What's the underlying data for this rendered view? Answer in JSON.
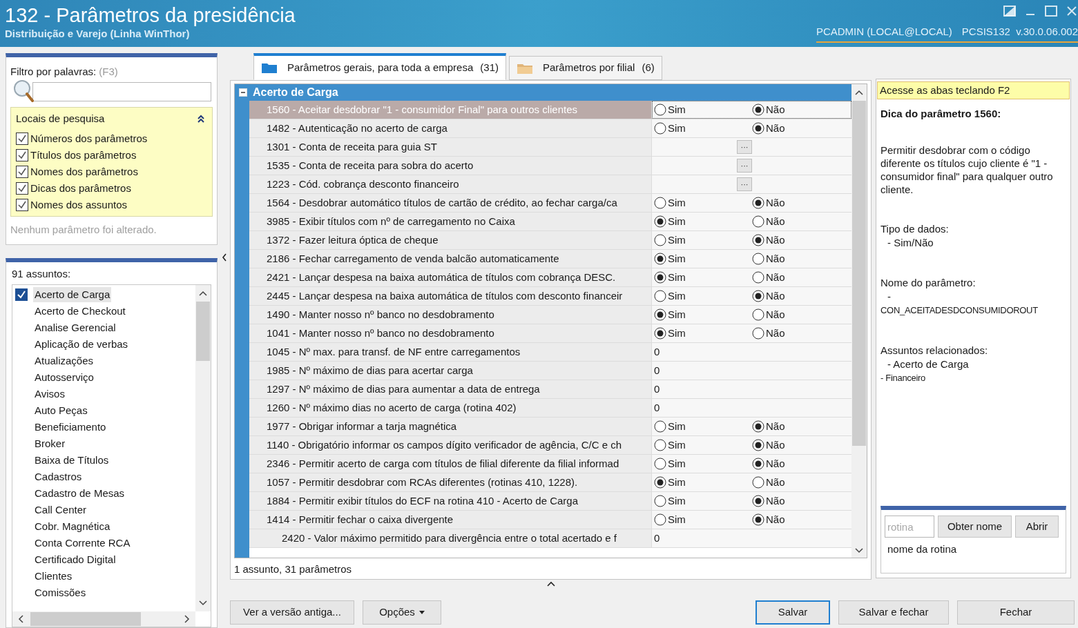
{
  "window": {
    "title": "132 - Parâmetros da presidência",
    "subtitle": "Distribuição e Varejo (Linha WinThor)",
    "user_info": "PCADMIN (LOCAL@LOCAL)",
    "routine_info": "PCSIS132  v.30.0.06.002"
  },
  "filter": {
    "label": "Filtro por palavras:",
    "shortcut": "(F3)",
    "search_places": {
      "title": "Locais de pesquisa",
      "expanded": true,
      "options": [
        {
          "label": "Números dos parâmetros",
          "checked": true
        },
        {
          "label": "Títulos dos parâmetros",
          "checked": true
        },
        {
          "label": "Nomes dos parâmetros",
          "checked": true
        },
        {
          "label": "Dicas dos parâmetros",
          "checked": true
        },
        {
          "label": "Nomes dos assuntos",
          "checked": true
        }
      ]
    },
    "status": "Nenhum parâmetro foi alterado."
  },
  "subjects": {
    "title": "91 assuntos:",
    "items": [
      {
        "label": "Acerto de Carga",
        "checked": true,
        "selected": true
      },
      {
        "label": "Acerto de Checkout",
        "checked": false,
        "selected": false
      },
      {
        "label": "Analise Gerencial",
        "checked": false,
        "selected": false
      },
      {
        "label": "Aplicação de verbas",
        "checked": false,
        "selected": false
      },
      {
        "label": "Atualizações",
        "checked": false,
        "selected": false
      },
      {
        "label": "Autosserviço",
        "checked": false,
        "selected": false
      },
      {
        "label": "Avisos",
        "checked": false,
        "selected": false
      },
      {
        "label": "Auto Peças",
        "checked": false,
        "selected": false
      },
      {
        "label": "Beneficiamento",
        "checked": false,
        "selected": false
      },
      {
        "label": "Broker",
        "checked": false,
        "selected": false
      },
      {
        "label": "Baixa de Títulos",
        "checked": false,
        "selected": false
      },
      {
        "label": "Cadastros",
        "checked": false,
        "selected": false
      },
      {
        "label": "Cadastro de Mesas",
        "checked": false,
        "selected": false
      },
      {
        "label": "Call Center",
        "checked": false,
        "selected": false
      },
      {
        "label": "Cobr. Magnética",
        "checked": false,
        "selected": false
      },
      {
        "label": "Conta Corrente RCA",
        "checked": false,
        "selected": false
      },
      {
        "label": "Certificado Digital",
        "checked": false,
        "selected": false
      },
      {
        "label": "Clientes",
        "checked": false,
        "selected": false
      },
      {
        "label": "Comissões",
        "checked": false,
        "selected": false
      }
    ]
  },
  "tabs": [
    {
      "label": "Parâmetros gerais, para toda a empresa",
      "count": "(31)",
      "selected": true
    },
    {
      "label": "Parâmetros por filial",
      "count": "(6)",
      "selected": false
    }
  ],
  "grid": {
    "group": "Acerto de Carga",
    "expanded": true,
    "rows": [
      {
        "kind": "bool",
        "label": "1560 - Aceitar desdobrar \"1 - consumidor Final\" para outros clientes",
        "selected": true,
        "options": [
          {
            "label": "Sim",
            "selected": false
          },
          {
            "label": "Não",
            "selected": true
          }
        ]
      },
      {
        "kind": "bool",
        "label": "1482 - Autenticação no acerto de carga",
        "selected": false,
        "options": [
          {
            "label": "Sim",
            "selected": false
          },
          {
            "label": "Não",
            "selected": true
          }
        ]
      },
      {
        "kind": "lookup",
        "label": "1301 - Conta de receita para guia ST",
        "selected": false,
        "button": "···"
      },
      {
        "kind": "lookup",
        "label": "1535 - Conta de receita para sobra do acerto",
        "selected": false,
        "button": "···"
      },
      {
        "kind": "lookup",
        "label": "1223 - Cód. cobrança desconto financeiro",
        "selected": false,
        "button": "···"
      },
      {
        "kind": "bool",
        "label": "1564 - Desdobrar automático títulos de cartão de crédito, ao fechar carga/ca",
        "selected": false,
        "options": [
          {
            "label": "Sim",
            "selected": false
          },
          {
            "label": "Não",
            "selected": true
          }
        ]
      },
      {
        "kind": "bool",
        "label": "3985 - Exibir títulos com nº de carregamento no Caixa",
        "selected": false,
        "options": [
          {
            "label": "Sim",
            "selected": true
          },
          {
            "label": "Não",
            "selected": false
          }
        ]
      },
      {
        "kind": "bool",
        "label": "1372 - Fazer leitura óptica de cheque",
        "selected": false,
        "options": [
          {
            "label": "Sim",
            "selected": false
          },
          {
            "label": "Não",
            "selected": true
          }
        ]
      },
      {
        "kind": "bool",
        "label": "2186 - Fechar carregamento de venda balcão automaticamente",
        "selected": false,
        "options": [
          {
            "label": "Sim",
            "selected": true
          },
          {
            "label": "Não",
            "selected": false
          }
        ]
      },
      {
        "kind": "bool",
        "label": "2421 - Lançar despesa na baixa automática de títulos com cobrança DESC.",
        "selected": false,
        "options": [
          {
            "label": "Sim",
            "selected": true
          },
          {
            "label": "Não",
            "selected": false
          }
        ]
      },
      {
        "kind": "bool",
        "label": "2445 - Lançar despesa na baixa automática de títulos com desconto financeir",
        "selected": false,
        "options": [
          {
            "label": "Sim",
            "selected": false
          },
          {
            "label": "Não",
            "selected": true
          }
        ]
      },
      {
        "kind": "bool",
        "label": "1490 - Manter nosso nº banco no desdobramento",
        "selected": false,
        "options": [
          {
            "label": "Sim",
            "selected": true
          },
          {
            "label": "Não",
            "selected": false
          }
        ]
      },
      {
        "kind": "bool",
        "label": "1041 - Manter nosso nº banco no desdobramento",
        "selected": false,
        "options": [
          {
            "label": "Sim",
            "selected": true
          },
          {
            "label": "Não",
            "selected": false
          }
        ]
      },
      {
        "kind": "number",
        "label": "1045 - Nº max. para transf. de NF entre carregamentos",
        "selected": false,
        "value": "0"
      },
      {
        "kind": "number",
        "label": "1985 - Nº máximo de dias para acertar carga",
        "selected": false,
        "value": "0"
      },
      {
        "kind": "number",
        "label": "1297 - Nº máximo de dias para aumentar a data de entrega",
        "selected": false,
        "value": "0"
      },
      {
        "kind": "number",
        "label": "1260 - Nº máximo dias no acerto de carga (rotina 402)",
        "selected": false,
        "value": "0"
      },
      {
        "kind": "bool",
        "label": "1977 - Obrigar informar a tarja magnética",
        "selected": false,
        "options": [
          {
            "label": "Sim",
            "selected": false
          },
          {
            "label": "Não",
            "selected": true
          }
        ]
      },
      {
        "kind": "bool",
        "label": "1140 - Obrigatório informar os campos dígito verificador de agência, C/C e ch",
        "selected": false,
        "options": [
          {
            "label": "Sim",
            "selected": false
          },
          {
            "label": "Não",
            "selected": true
          }
        ]
      },
      {
        "kind": "bool",
        "label": "2346 - Permitir acerto de carga com títulos de filial diferente da filial informad",
        "selected": false,
        "options": [
          {
            "label": "Sim",
            "selected": false
          },
          {
            "label": "Não",
            "selected": true
          }
        ]
      },
      {
        "kind": "bool",
        "label": "1057 - Permitir desdobrar com RCAs diferentes (rotinas 410, 1228).",
        "selected": false,
        "options": [
          {
            "label": "Sim",
            "selected": true
          },
          {
            "label": "Não",
            "selected": false
          }
        ]
      },
      {
        "kind": "bool",
        "label": "1884 - Permitir exibir títulos do ECF na rotina 410 - Acerto de Carga",
        "selected": false,
        "options": [
          {
            "label": "Sim",
            "selected": false
          },
          {
            "label": "Não",
            "selected": true
          }
        ]
      },
      {
        "kind": "bool",
        "label": "1414 - Permitir fechar o caixa divergente",
        "selected": false,
        "options": [
          {
            "label": "Sim",
            "selected": false
          },
          {
            "label": "Não",
            "selected": true
          }
        ],
        "children": [
          {
            "kind": "number",
            "label": "2420 - Valor máximo permitido para divergência entre o total acertado e f",
            "selected": false,
            "value": "0"
          }
        ]
      }
    ]
  },
  "summary": "1 assunto, 31 parâmetros",
  "hint": {
    "banner": "Acesse as abas teclando F2",
    "title": "Dica do parâmetro 1560:",
    "description": "Permitir desdobrar com o código diferente os títulos cujo cliente é \"1 - consumidor final\" para qualquer outro cliente.",
    "sections": [
      {
        "heading": "Tipo de dados:",
        "lines": [
          "- Sim/Não"
        ]
      },
      {
        "heading": "Nome do parâmetro:",
        "lines": [
          "-",
          "CON_ACEITADESDCONSUMIDOROUT"
        ]
      },
      {
        "heading": "Assuntos relacionados:",
        "lines": [
          "- Acerto de Carga",
          "- Financeiro"
        ]
      }
    ]
  },
  "routine_lookup": {
    "placeholder": "rotina",
    "buttons": [
      "Obter nome",
      "Abrir"
    ],
    "result": "nome da rotina"
  },
  "footer_buttons": [
    {
      "label": "Ver a versão antiga...",
      "kind": "plain"
    },
    {
      "label": "Opções",
      "kind": "menu"
    },
    {
      "label": "Salvar",
      "kind": "default"
    },
    {
      "label": "Salvar e fechar",
      "kind": "plain"
    },
    {
      "label": "Fechar",
      "kind": "plain"
    }
  ]
}
